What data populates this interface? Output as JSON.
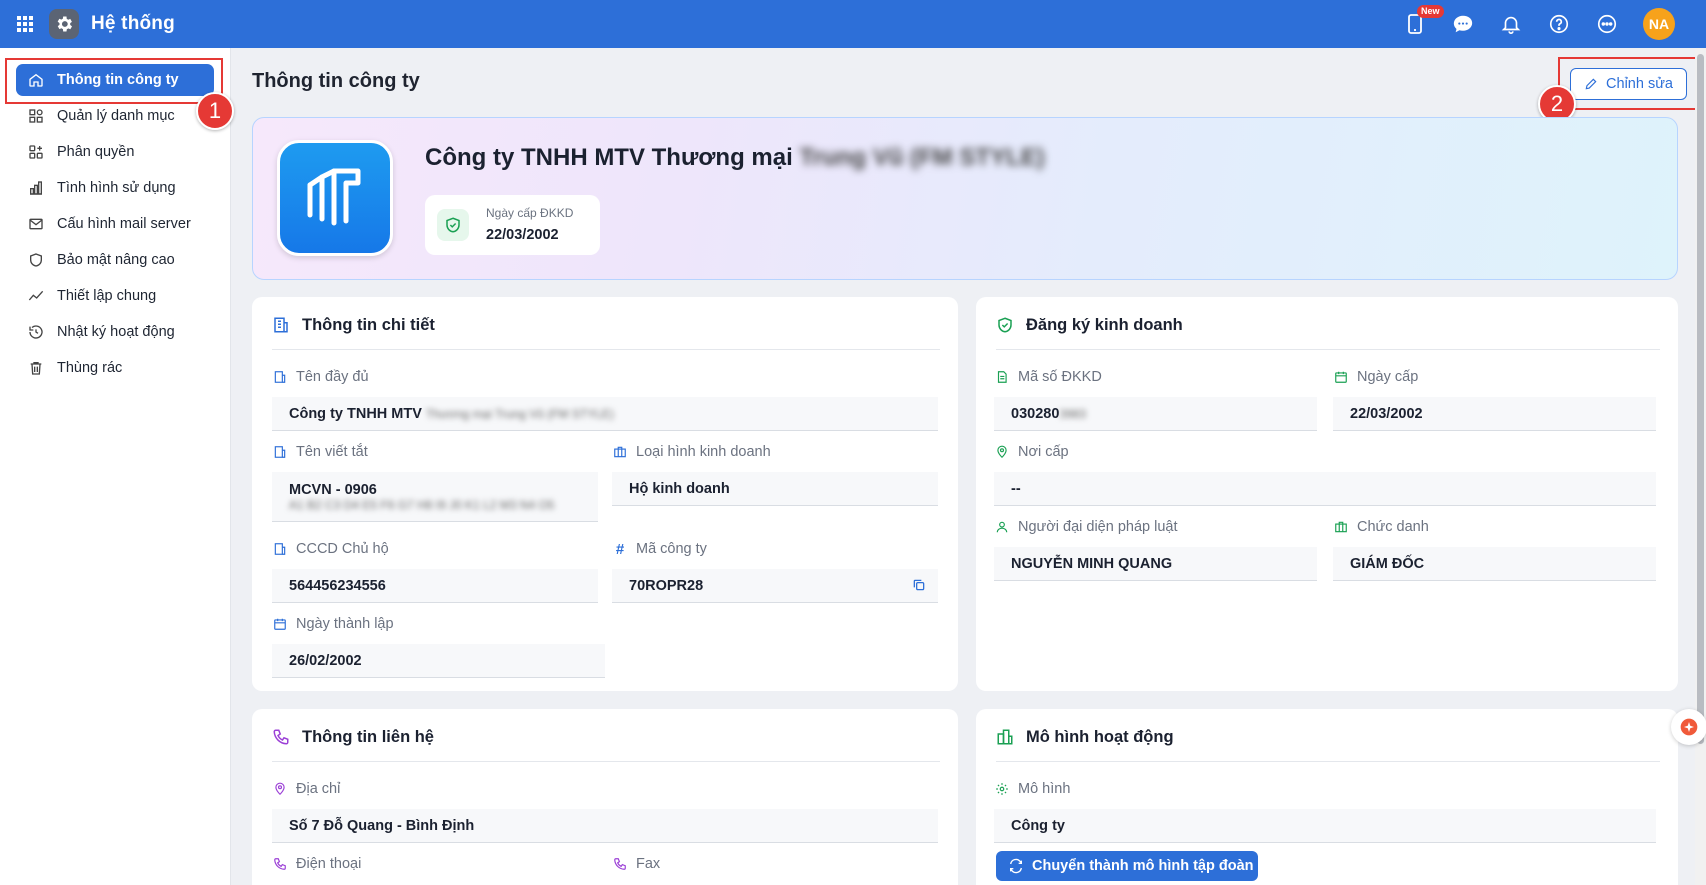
{
  "app": {
    "title": "Hệ thống",
    "avatar_initials": "NA",
    "new_badge": "New"
  },
  "colors": {
    "primary": "#2d6fd8",
    "avatar": "#f7a21b",
    "callout": "#e53935",
    "badge": "#e53935"
  },
  "sidebar": {
    "items": [
      {
        "label": "Thông tin công ty",
        "icon": "home-icon",
        "active": true
      },
      {
        "label": "Quản lý danh mục",
        "icon": "category-icon"
      },
      {
        "label": "Phân quyền",
        "icon": "permission-icon"
      },
      {
        "label": "Tình hình sử dụng",
        "icon": "bar-chart-icon"
      },
      {
        "label": "Cấu hình mail server",
        "icon": "mail-icon"
      },
      {
        "label": "Bảo mật nâng cao",
        "icon": "shield-icon"
      },
      {
        "label": "Thiết lập chung",
        "icon": "trend-icon"
      },
      {
        "label": "Nhật ký hoạt động",
        "icon": "history-icon"
      },
      {
        "label": "Thùng rác",
        "icon": "trash-icon"
      }
    ]
  },
  "callouts": {
    "one": "1",
    "two": "2"
  },
  "main": {
    "page_title": "Thông tin công ty",
    "edit_label": "Chỉnh sửa",
    "hero": {
      "company_name": "Công ty TNHH MTV Thương mại",
      "company_name_blurred": "Trung Vũ (FM STYLE)",
      "date_label": "Ngày cấp ĐKKD",
      "date_value": "22/03/2002"
    },
    "detail": {
      "title": "Thông tin chi tiết",
      "full_name_label": "Tên đầy đủ",
      "full_name_value": "Công ty TNHH MTV",
      "full_name_blurred": "Thương mại Trung Vũ (FM STYLE)",
      "short_name_label": "Tên viết tắt",
      "short_name_value": "MCVN - 0906",
      "short_name_blurred": "A1 B2 C3 D4 E5 F6 G7 H8 I9 J0 K1 L2 M3 N4 O5",
      "business_type_label": "Loại hình kinh doanh",
      "business_type_value": "Hộ kinh doanh",
      "cccd_label": "CCCD Chủ hộ",
      "cccd_value": "564456234556",
      "company_code_label": "Mã công ty",
      "company_code_value": "70ROPR28",
      "founded_label": "Ngày thành lập",
      "founded_value": "26/02/2002"
    },
    "registration": {
      "title": "Đăng ký kinh doanh",
      "reg_no_label": "Mã số ĐKKD",
      "reg_no_value": "030280",
      "reg_no_blurred": "3983",
      "issue_date_label": "Ngày cấp",
      "issue_date_value": "22/03/2002",
      "issue_place_label": "Nơi cấp",
      "issue_place_value": "--",
      "rep_label": "Người đại diện pháp luật",
      "rep_value": "NGUYỄN MINH QUANG",
      "position_label": "Chức danh",
      "position_value": "GIÁM ĐỐC"
    },
    "contact": {
      "title": "Thông tin liên hệ",
      "address_label": "Địa chỉ",
      "address_value": "Số 7 Đỗ Quang - Bình Định",
      "phone_label": "Điện thoại",
      "fax_label": "Fax"
    },
    "operation": {
      "title": "Mô hình hoạt động",
      "model_label": "Mô hình",
      "model_value": "Công ty",
      "convert_label": "Chuyển thành mô hình tập đoàn"
    }
  }
}
